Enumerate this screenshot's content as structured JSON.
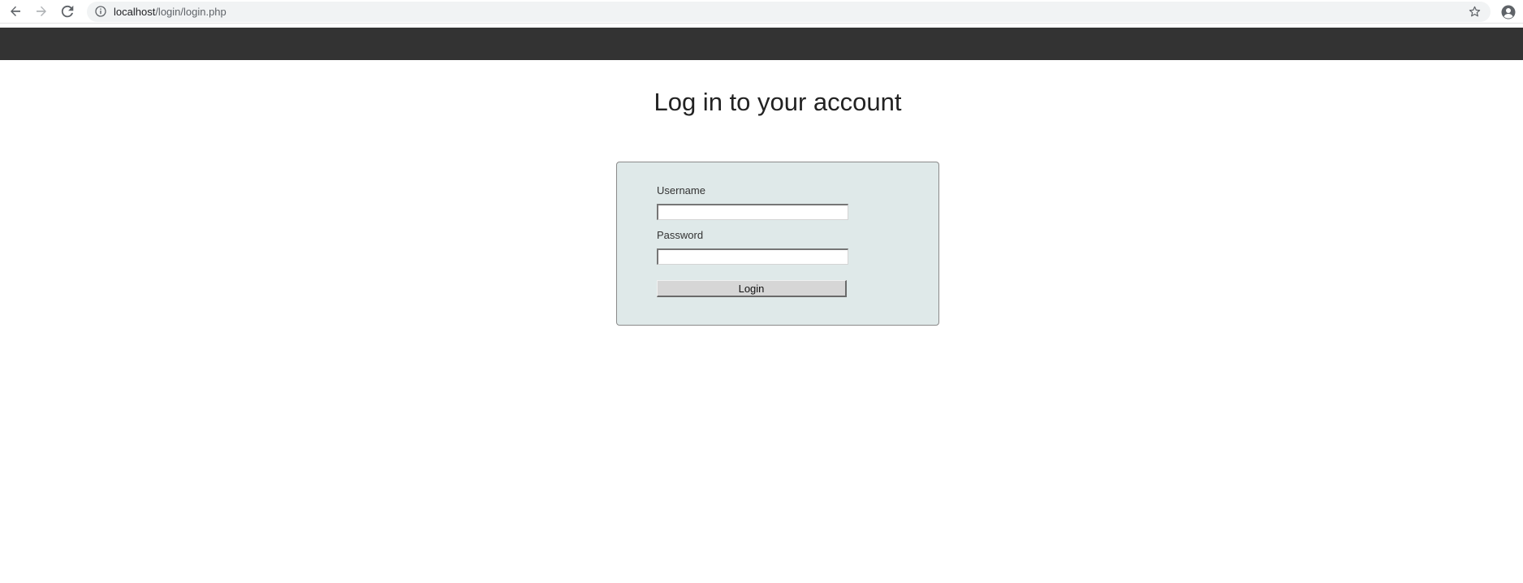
{
  "browser": {
    "url_host": "localhost",
    "url_path": "/login/login.php",
    "icons": {
      "back": "back-arrow-icon",
      "forward": "forward-arrow-icon",
      "reload": "reload-icon",
      "site_info": "info-icon",
      "bookmark": "star-icon",
      "profile": "avatar-icon"
    }
  },
  "header": {
    "background_color": "#333333"
  },
  "page": {
    "title": "Log in to your account"
  },
  "login_form": {
    "background_color": "#dfe9e9",
    "username_label": "Username",
    "username_value": "",
    "password_label": "Password",
    "password_value": "",
    "submit_label": "Login"
  }
}
